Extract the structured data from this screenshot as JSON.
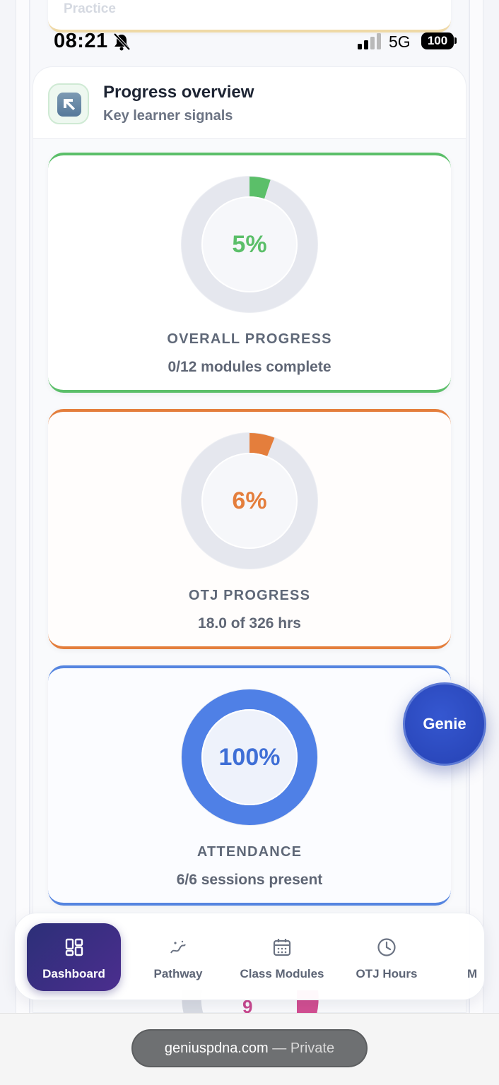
{
  "status_bar": {
    "time": "08:21",
    "network": "5G",
    "battery": "100"
  },
  "previous_card": {
    "label": "Practice"
  },
  "overview": {
    "title": "Progress overview",
    "subtitle": "Key learner signals",
    "icon": "arrow-up-left-icon"
  },
  "metrics": [
    {
      "value_text": "5%",
      "percent": 5,
      "label": "OVERALL PROGRESS",
      "detail": "0/12 modules complete",
      "color": "#5bbf69"
    },
    {
      "value_text": "6%",
      "percent": 6,
      "label": "OTJ PROGRESS",
      "detail": "18.0 of 326 hrs",
      "color": "#e47e3c"
    },
    {
      "value_text": "100%",
      "percent": 100,
      "label": "ATTENDANCE",
      "detail": "6/6 sessions present",
      "color": "#4f80e6"
    }
  ],
  "next_card_peek": {
    "value_fragment": "9"
  },
  "genie": {
    "label": "Genie"
  },
  "bottom_nav": {
    "items": [
      {
        "label": "Dashboard",
        "icon": "dashboard-icon",
        "active": true
      },
      {
        "label": "Pathway",
        "icon": "pathway-icon",
        "active": false
      },
      {
        "label": "Class Modules",
        "icon": "calendar-icon",
        "active": false
      },
      {
        "label": "OTJ Hours",
        "icon": "clock-icon",
        "active": false
      },
      {
        "label": "M",
        "icon": "more-icon",
        "active": false
      }
    ]
  },
  "browser": {
    "domain": "geniuspdna.com",
    "separator": " — ",
    "mode": "Private"
  }
}
